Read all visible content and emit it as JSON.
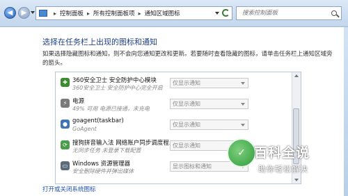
{
  "address_bar": {
    "breadcrumbs": [
      "控制面板",
      "所有控制面板项",
      "通知区域图标"
    ],
    "separator": "▸"
  },
  "search": {
    "placeholder": "搜索控制面板"
  },
  "main": {
    "title": "选择在任务栏上出现的图标和通知",
    "description": "如果选择隐藏图标和通知，则不会向您通知更改和更新。若要随时查看隐藏的图标，请单击任务栏上通知区域旁的箭头。"
  },
  "icons_list": {
    "rows": [
      {
        "name": "360安全卫士 安全防护中心模块",
        "subtitle": "360安全卫士 安全防护中心完全开启",
        "behavior": "仅显示通知",
        "icon": "shield-360-icon",
        "icon_color": "#3a8c2f"
      },
      {
        "name": "电源",
        "subtitle": "49% 可用 电源已接通，未充电",
        "behavior": "仅显示通知",
        "icon": "power-plug-icon",
        "icon_color": "#7a7a7a"
      },
      {
        "name": "goagent(taskbar)",
        "subtitle": "GoAgent",
        "behavior": "仅显示通知",
        "icon": "python-icon",
        "icon_color": "#3f74b4"
      },
      {
        "name": "搜狗拼音输入法 网络账户同步调度程...",
        "subtitle": "无同步任务 未登录下载配置",
        "behavior": "仅显示通知",
        "icon": "sogou-sync-icon",
        "icon_color": "#4a9c4a"
      },
      {
        "name": "Windows 资源管理器",
        "subtitle": "安全删除硬件并弹出媒体",
        "behavior": "显示图标和通知",
        "icon": "usb-device-icon",
        "icon_color": "#5b6b7a"
      }
    ]
  },
  "footer": {
    "link": "打开或关闭系统图标"
  },
  "watermark": {
    "title": "百科全说",
    "subtitle": "助你轻松解决"
  },
  "colors": {
    "title": "#1e3f8a",
    "link": "#1f4fb3",
    "chrome": "#c3d6ec"
  }
}
